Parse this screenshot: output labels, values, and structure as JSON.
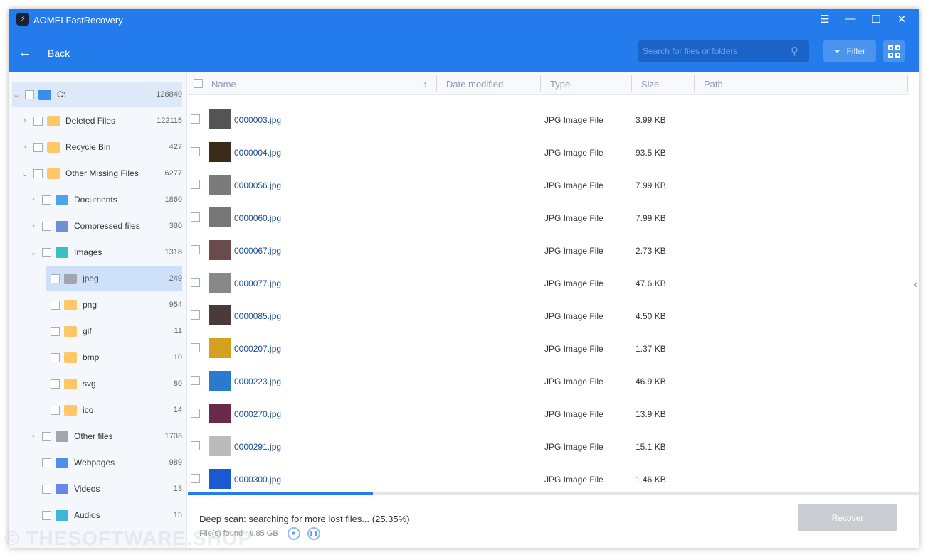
{
  "app": {
    "title": "AOMEI FastRecovery",
    "back_label": "Back",
    "search_placeholder": "Search for files or folders",
    "filter_label": "Filter",
    "accent": "#237bec"
  },
  "tree": [
    {
      "label": "C:",
      "count": "128849",
      "level": 0,
      "chev": "down",
      "icon": "drive-icon",
      "color": "#3a8ef0",
      "root": true
    },
    {
      "label": "Deleted Files",
      "count": "122115",
      "level": 1,
      "chev": "right",
      "icon": "deleted-folder-icon",
      "color": "#ffc766"
    },
    {
      "label": "Recycle Bin",
      "count": "427",
      "level": 1,
      "chev": "right",
      "icon": "recycle-bin-icon",
      "color": "#ffc766"
    },
    {
      "label": "Other Missing Files",
      "count": "6277",
      "level": 1,
      "chev": "down",
      "icon": "missing-folder-icon",
      "color": "#ffc766"
    },
    {
      "label": "Documents",
      "count": "1860",
      "level": 2,
      "chev": "right",
      "icon": "documents-icon",
      "color": "#4fa3e8"
    },
    {
      "label": "Compressed files",
      "count": "380",
      "level": 2,
      "chev": "right",
      "icon": "compressed-icon",
      "color": "#6e8fd6"
    },
    {
      "label": "Images",
      "count": "1318",
      "level": 2,
      "chev": "down",
      "icon": "images-icon",
      "color": "#3cbfbf"
    },
    {
      "label": "jpeg",
      "count": "249",
      "level": 3,
      "chev": "",
      "icon": "folder-icon",
      "color": "#a0a6ae",
      "selected": true
    },
    {
      "label": "png",
      "count": "954",
      "level": 3,
      "chev": "",
      "icon": "folder-icon",
      "color": "#ffc766"
    },
    {
      "label": "gif",
      "count": "11",
      "level": 3,
      "chev": "",
      "icon": "folder-icon",
      "color": "#ffc766"
    },
    {
      "label": "bmp",
      "count": "10",
      "level": 3,
      "chev": "",
      "icon": "folder-icon",
      "color": "#ffc766"
    },
    {
      "label": "svg",
      "count": "80",
      "level": 3,
      "chev": "",
      "icon": "folder-icon",
      "color": "#ffc766"
    },
    {
      "label": "ico",
      "count": "14",
      "level": 3,
      "chev": "",
      "icon": "folder-icon",
      "color": "#ffc766"
    },
    {
      "label": "Other files",
      "count": "1703",
      "level": 2,
      "chev": "right",
      "icon": "other-files-icon",
      "color": "#a0a6ae"
    },
    {
      "label": "Webpages",
      "count": "989",
      "level": 2,
      "chev": "",
      "icon": "webpages-icon",
      "color": "#4f8fe8"
    },
    {
      "label": "Videos",
      "count": "13",
      "level": 2,
      "chev": "",
      "icon": "videos-icon",
      "color": "#6a86e6"
    },
    {
      "label": "Audios",
      "count": "15",
      "level": 2,
      "chev": "",
      "icon": "audios-icon",
      "color": "#3fb6d8"
    }
  ],
  "columns": [
    "Name",
    "Date modified",
    "Type",
    "Size",
    "Path"
  ],
  "files": [
    {
      "name": "0000003.jpg",
      "type": "JPG Image File",
      "size": "3.99 KB"
    },
    {
      "name": "0000004.jpg",
      "type": "JPG Image File",
      "size": "93.5 KB"
    },
    {
      "name": "0000056.jpg",
      "type": "JPG Image File",
      "size": "7.99 KB"
    },
    {
      "name": "0000060.jpg",
      "type": "JPG Image File",
      "size": "7.99 KB"
    },
    {
      "name": "0000067.jpg",
      "type": "JPG Image File",
      "size": "2.73 KB"
    },
    {
      "name": "0000077.jpg",
      "type": "JPG Image File",
      "size": "47.6 KB"
    },
    {
      "name": "0000085.jpg",
      "type": "JPG Image File",
      "size": "4.50 KB"
    },
    {
      "name": "0000207.jpg",
      "type": "JPG Image File",
      "size": "1.37 KB"
    },
    {
      "name": "0000223.jpg",
      "type": "JPG Image File",
      "size": "46.9 KB"
    },
    {
      "name": "0000270.jpg",
      "type": "JPG Image File",
      "size": "13.9 KB"
    },
    {
      "name": "0000291.jpg",
      "type": "JPG Image File",
      "size": "15.1 KB"
    },
    {
      "name": "0000300.jpg",
      "type": "JPG Image File",
      "size": "1.46 KB"
    }
  ],
  "status": {
    "text": "Deep scan: searching for more lost files... (25.35%)",
    "progress_percent": 25.35,
    "found": "File(s) found : 9.85 GB",
    "recover_label": "Recover"
  },
  "watermark": "© THESOFTWARE.SHOP"
}
